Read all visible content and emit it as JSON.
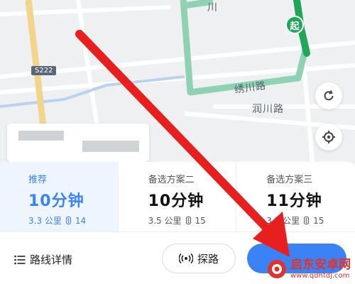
{
  "map": {
    "road_labels": [
      "川",
      "绣川路",
      "润川路"
    ],
    "highway_badge": "S222",
    "start_marker": "起"
  },
  "routes": [
    {
      "name": "推荐",
      "time": "10分钟",
      "distance": "3.3 公里",
      "lights": "14",
      "active": true
    },
    {
      "name": "备选方案二",
      "time": "10分钟",
      "distance": "3.5 公里",
      "lights": "15",
      "active": false
    },
    {
      "name": "备选方案三",
      "time": "11分钟",
      "distance": "3.5 公里",
      "lights": "15",
      "active": false
    }
  ],
  "actions": {
    "detail_label": "路线详情",
    "explore_label": "探路"
  },
  "colors": {
    "accent": "#3b82f6",
    "route_green": "#1fa659",
    "alt_route": "#8fd1b3",
    "arrow_red": "#e81f1f"
  },
  "watermark": {
    "title": "启东安卓网",
    "url": "www.qdhtdj.com"
  }
}
